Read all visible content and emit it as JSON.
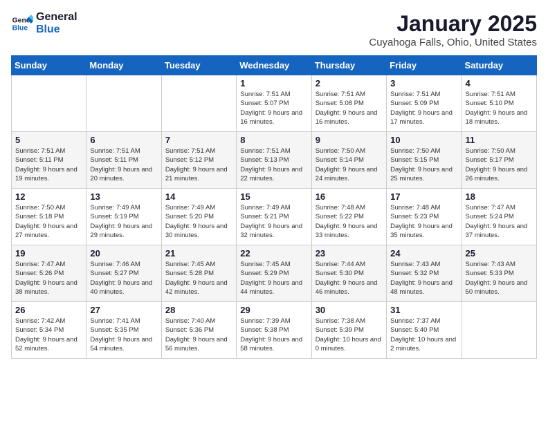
{
  "logo": {
    "line1": "General",
    "line2": "Blue"
  },
  "title": "January 2025",
  "subtitle": "Cuyahoga Falls, Ohio, United States",
  "headers": [
    "Sunday",
    "Monday",
    "Tuesday",
    "Wednesday",
    "Thursday",
    "Friday",
    "Saturday"
  ],
  "weeks": [
    [
      {
        "day": "",
        "info": ""
      },
      {
        "day": "",
        "info": ""
      },
      {
        "day": "",
        "info": ""
      },
      {
        "day": "1",
        "info": "Sunrise: 7:51 AM\nSunset: 5:07 PM\nDaylight: 9 hours\nand 16 minutes."
      },
      {
        "day": "2",
        "info": "Sunrise: 7:51 AM\nSunset: 5:08 PM\nDaylight: 9 hours\nand 16 minutes."
      },
      {
        "day": "3",
        "info": "Sunrise: 7:51 AM\nSunset: 5:09 PM\nDaylight: 9 hours\nand 17 minutes."
      },
      {
        "day": "4",
        "info": "Sunrise: 7:51 AM\nSunset: 5:10 PM\nDaylight: 9 hours\nand 18 minutes."
      }
    ],
    [
      {
        "day": "5",
        "info": "Sunrise: 7:51 AM\nSunset: 5:11 PM\nDaylight: 9 hours\nand 19 minutes."
      },
      {
        "day": "6",
        "info": "Sunrise: 7:51 AM\nSunset: 5:11 PM\nDaylight: 9 hours\nand 20 minutes."
      },
      {
        "day": "7",
        "info": "Sunrise: 7:51 AM\nSunset: 5:12 PM\nDaylight: 9 hours\nand 21 minutes."
      },
      {
        "day": "8",
        "info": "Sunrise: 7:51 AM\nSunset: 5:13 PM\nDaylight: 9 hours\nand 22 minutes."
      },
      {
        "day": "9",
        "info": "Sunrise: 7:50 AM\nSunset: 5:14 PM\nDaylight: 9 hours\nand 24 minutes."
      },
      {
        "day": "10",
        "info": "Sunrise: 7:50 AM\nSunset: 5:15 PM\nDaylight: 9 hours\nand 25 minutes."
      },
      {
        "day": "11",
        "info": "Sunrise: 7:50 AM\nSunset: 5:17 PM\nDaylight: 9 hours\nand 26 minutes."
      }
    ],
    [
      {
        "day": "12",
        "info": "Sunrise: 7:50 AM\nSunset: 5:18 PM\nDaylight: 9 hours\nand 27 minutes."
      },
      {
        "day": "13",
        "info": "Sunrise: 7:49 AM\nSunset: 5:19 PM\nDaylight: 9 hours\nand 29 minutes."
      },
      {
        "day": "14",
        "info": "Sunrise: 7:49 AM\nSunset: 5:20 PM\nDaylight: 9 hours\nand 30 minutes."
      },
      {
        "day": "15",
        "info": "Sunrise: 7:49 AM\nSunset: 5:21 PM\nDaylight: 9 hours\nand 32 minutes."
      },
      {
        "day": "16",
        "info": "Sunrise: 7:48 AM\nSunset: 5:22 PM\nDaylight: 9 hours\nand 33 minutes."
      },
      {
        "day": "17",
        "info": "Sunrise: 7:48 AM\nSunset: 5:23 PM\nDaylight: 9 hours\nand 35 minutes."
      },
      {
        "day": "18",
        "info": "Sunrise: 7:47 AM\nSunset: 5:24 PM\nDaylight: 9 hours\nand 37 minutes."
      }
    ],
    [
      {
        "day": "19",
        "info": "Sunrise: 7:47 AM\nSunset: 5:26 PM\nDaylight: 9 hours\nand 38 minutes."
      },
      {
        "day": "20",
        "info": "Sunrise: 7:46 AM\nSunset: 5:27 PM\nDaylight: 9 hours\nand 40 minutes."
      },
      {
        "day": "21",
        "info": "Sunrise: 7:45 AM\nSunset: 5:28 PM\nDaylight: 9 hours\nand 42 minutes."
      },
      {
        "day": "22",
        "info": "Sunrise: 7:45 AM\nSunset: 5:29 PM\nDaylight: 9 hours\nand 44 minutes."
      },
      {
        "day": "23",
        "info": "Sunrise: 7:44 AM\nSunset: 5:30 PM\nDaylight: 9 hours\nand 46 minutes."
      },
      {
        "day": "24",
        "info": "Sunrise: 7:43 AM\nSunset: 5:32 PM\nDaylight: 9 hours\nand 48 minutes."
      },
      {
        "day": "25",
        "info": "Sunrise: 7:43 AM\nSunset: 5:33 PM\nDaylight: 9 hours\nand 50 minutes."
      }
    ],
    [
      {
        "day": "26",
        "info": "Sunrise: 7:42 AM\nSunset: 5:34 PM\nDaylight: 9 hours\nand 52 minutes."
      },
      {
        "day": "27",
        "info": "Sunrise: 7:41 AM\nSunset: 5:35 PM\nDaylight: 9 hours\nand 54 minutes."
      },
      {
        "day": "28",
        "info": "Sunrise: 7:40 AM\nSunset: 5:36 PM\nDaylight: 9 hours\nand 56 minutes."
      },
      {
        "day": "29",
        "info": "Sunrise: 7:39 AM\nSunset: 5:38 PM\nDaylight: 9 hours\nand 58 minutes."
      },
      {
        "day": "30",
        "info": "Sunrise: 7:38 AM\nSunset: 5:39 PM\nDaylight: 10 hours\nand 0 minutes."
      },
      {
        "day": "31",
        "info": "Sunrise: 7:37 AM\nSunset: 5:40 PM\nDaylight: 10 hours\nand 2 minutes."
      },
      {
        "day": "",
        "info": ""
      }
    ]
  ]
}
